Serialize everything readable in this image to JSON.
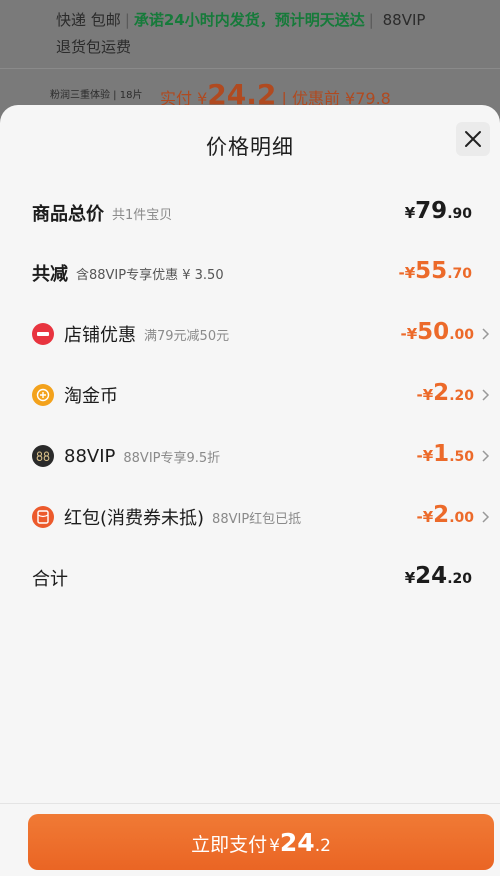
{
  "background": {
    "shipping_label": "快递",
    "free_shipping": "包邮",
    "promise": "承诺24小时内发货，预计明天送达",
    "vip": "88VIP",
    "return_label": "退货包运费",
    "product_tag": "粉润三重体验 | 18片",
    "paid_prefix": "实付 ¥",
    "paid_big": "24.2",
    "discount_text": "| 优惠前 ¥79.8"
  },
  "sheet": {
    "title": "价格明细",
    "close_icon": "close-icon"
  },
  "rows": {
    "total": {
      "label": "商品总价",
      "sub": "共1件宝贝",
      "pre": "¥",
      "main": "79",
      "dec": ".90"
    },
    "reduce": {
      "label": "共减",
      "sub": "含88VIP专享优惠 ¥ 3.50",
      "pre": "-¥",
      "main": "55",
      "dec": ".70"
    },
    "shop": {
      "label": "店铺优惠",
      "sub": "满79元减50元",
      "pre": "-¥",
      "main": "50",
      "dec": ".00",
      "icon": "shop-discount-icon",
      "color": "#e8343f"
    },
    "coin": {
      "label": "淘金币",
      "sub": "",
      "pre": "-¥",
      "main": "2",
      "dec": ".20",
      "icon": "gold-coin-icon",
      "color": "#f3a21c"
    },
    "vip": {
      "label": "88VIP",
      "sub": "88VIP专享9.5折",
      "pre": "-¥",
      "main": "1",
      "dec": ".50",
      "icon": "vip-88-icon",
      "color": "#2a2a2a"
    },
    "redpacket": {
      "label": "红包(消费券未抵)",
      "sub": "88VIP红包已抵",
      "pre": "-¥",
      "main": "2",
      "dec": ".00",
      "icon": "red-packet-icon",
      "color": "#ec5a2c"
    },
    "sum": {
      "label": "合计",
      "pre": "¥",
      "main": "24",
      "dec": ".20"
    }
  },
  "pay": {
    "label": "立即支付",
    "yen": "¥",
    "main": "24",
    "dec": ".2"
  },
  "colors": {
    "accent": "#ec6a2a",
    "button": "#ee6f2c"
  }
}
